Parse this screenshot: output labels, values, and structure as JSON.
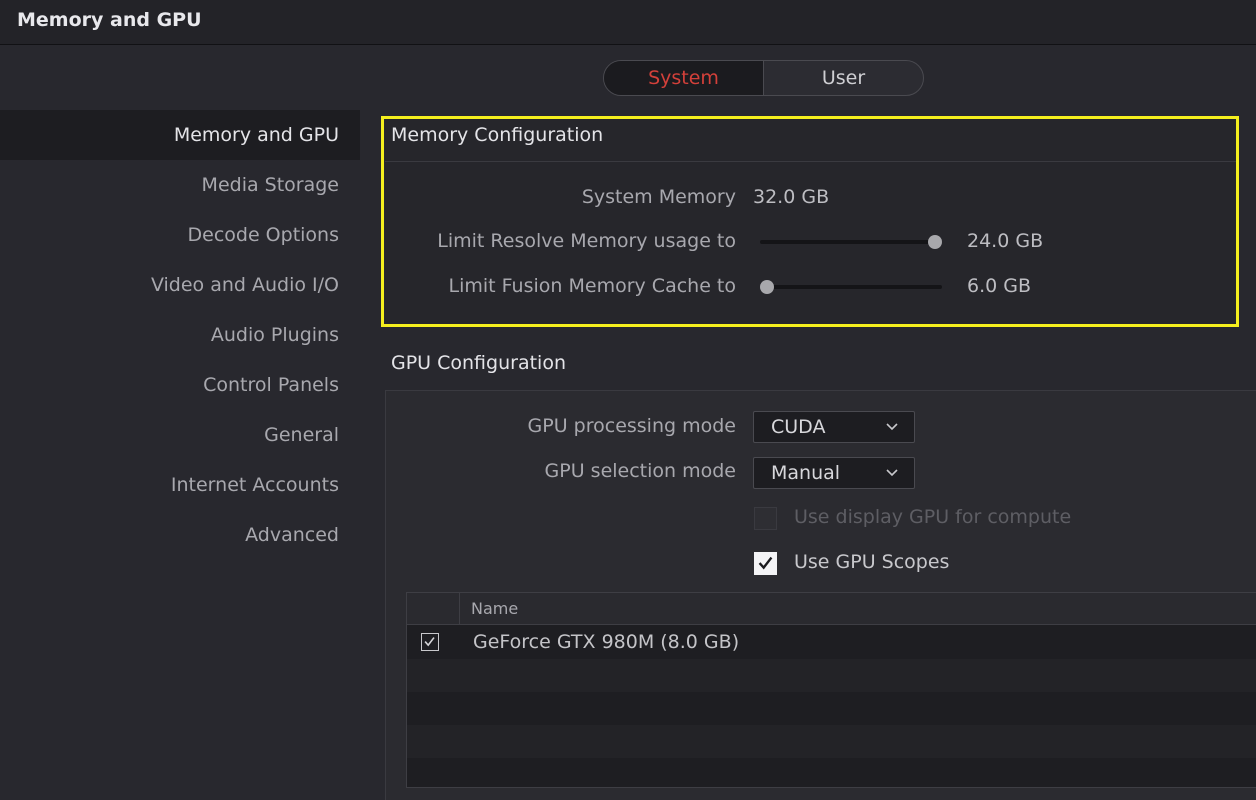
{
  "window": {
    "title": "Memory and GPU"
  },
  "tabs": [
    {
      "label": "System",
      "active": true
    },
    {
      "label": "User",
      "active": false
    }
  ],
  "sidebar": {
    "items": [
      {
        "label": "Memory and GPU",
        "active": true
      },
      {
        "label": "Media Storage"
      },
      {
        "label": "Decode Options"
      },
      {
        "label": "Video and Audio I/O"
      },
      {
        "label": "Audio Plugins"
      },
      {
        "label": "Control Panels"
      },
      {
        "label": "General"
      },
      {
        "label": "Internet Accounts"
      },
      {
        "label": "Advanced"
      }
    ]
  },
  "memory": {
    "heading": "Memory Configuration",
    "system_memory_label": "System Memory",
    "system_memory_value": "32.0 GB",
    "resolve_label": "Limit Resolve Memory usage to",
    "resolve_value": "24.0 GB",
    "resolve_fraction": 1.0,
    "fusion_label": "Limit Fusion Memory Cache to",
    "fusion_value": "6.0 GB",
    "fusion_fraction": 0.0
  },
  "gpu": {
    "heading": "GPU Configuration",
    "processing_label": "GPU processing mode",
    "processing_value": "CUDA",
    "selection_label": "GPU selection mode",
    "selection_value": "Manual",
    "display_gpu_label": "Use display GPU for compute",
    "display_gpu_checked": false,
    "scopes_label": "Use GPU Scopes",
    "scopes_checked": true,
    "table": {
      "columns": [
        "Name"
      ],
      "rows": [
        {
          "name": "GeForce GTX 980M (8.0 GB)",
          "checked": true
        }
      ]
    }
  },
  "colors": {
    "highlight": "#f5ef1e",
    "active_tab_text": "#d3403a"
  }
}
